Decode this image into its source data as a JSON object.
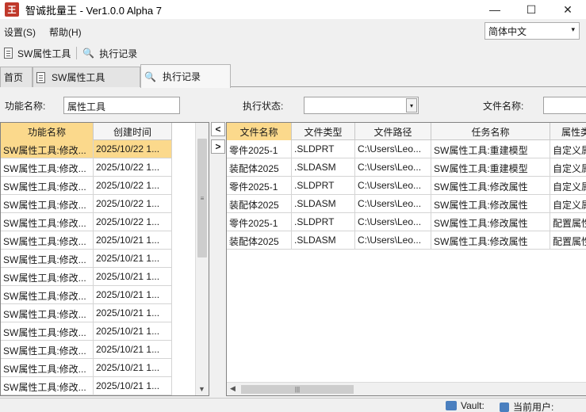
{
  "window": {
    "title": "智诚批量王 - Ver1.0.0 Alpha 7",
    "app_icon_text": "王",
    "minimize": "—",
    "maximize": "☐",
    "close": "✕"
  },
  "menu": {
    "items": [
      {
        "label": "设置(S)"
      },
      {
        "label": "帮助(H)"
      }
    ],
    "language": {
      "value": "简体中文",
      "arrow": "▾"
    }
  },
  "toolbar": {
    "sw_tool_label": "SW属性工具",
    "exec_log_label": "执行记录"
  },
  "tabs": [
    {
      "label": "首页"
    },
    {
      "label": "SW属性工具"
    },
    {
      "label": "执行记录"
    }
  ],
  "filters": {
    "function_name_label": "功能名称:",
    "function_name_value": "属性工具",
    "exec_status_label": "执行状态:",
    "exec_status_value": "",
    "combo_arrow": "▾",
    "file_name_label": "文件名称:",
    "file_name_value": ""
  },
  "left_table": {
    "columns": [
      "功能名称",
      "创建时间"
    ],
    "rows": [
      [
        "SW属性工具:修改...",
        "2025/10/22 1..."
      ],
      [
        "SW属性工具:修改...",
        "2025/10/22 1..."
      ],
      [
        "SW属性工具:修改...",
        "2025/10/22 1..."
      ],
      [
        "SW属性工具:修改...",
        "2025/10/22 1..."
      ],
      [
        "SW属性工具:修改...",
        "2025/10/22 1..."
      ],
      [
        "SW属性工具:修改...",
        "2025/10/21 1..."
      ],
      [
        "SW属性工具:修改...",
        "2025/10/21 1..."
      ],
      [
        "SW属性工具:修改...",
        "2025/10/21 1..."
      ],
      [
        "SW属性工具:修改...",
        "2025/10/21 1..."
      ],
      [
        "SW属性工具:修改...",
        "2025/10/21 1..."
      ],
      [
        "SW属性工具:修改...",
        "2025/10/21 1..."
      ],
      [
        "SW属性工具:修改...",
        "2025/10/21 1..."
      ],
      [
        "SW属性工具:修改...",
        "2025/10/21 1..."
      ],
      [
        "SW属性工具:修改...",
        "2025/10/21 1..."
      ]
    ],
    "selected_row": 0
  },
  "splitter": {
    "collapse": "<",
    "expand": ">"
  },
  "right_table": {
    "columns": [
      "文件名称",
      "文件类型",
      "文件路径",
      "任务名称",
      "属性类"
    ],
    "rows": [
      [
        "零件2025-1",
        ".SLDPRT",
        "C:\\Users\\Leo...",
        "SW属性工具:重建模型",
        "自定义属"
      ],
      [
        "装配体2025",
        ".SLDASM",
        "C:\\Users\\Leo...",
        "SW属性工具:重建模型",
        "自定义属"
      ],
      [
        "零件2025-1",
        ".SLDPRT",
        "C:\\Users\\Leo...",
        "SW属性工具:修改属性",
        "自定义属"
      ],
      [
        "装配体2025",
        ".SLDASM",
        "C:\\Users\\Leo...",
        "SW属性工具:修改属性",
        "自定义属"
      ],
      [
        "零件2025-1",
        ".SLDPRT",
        "C:\\Users\\Leo...",
        "SW属性工具:修改属性",
        "配置属性"
      ],
      [
        "装配体2025",
        ".SLDASM",
        "C:\\Users\\Leo...",
        "SW属性工具:修改属性",
        "配置属性"
      ]
    ]
  },
  "scroll": {
    "grip": "≡",
    "hgrip": "|||",
    "down": "▼",
    "left": "◀"
  },
  "status": {
    "vault_label": "Vault:",
    "user_label": "当前用户:"
  },
  "colors": {
    "selected": "#fbd98c",
    "app_icon": "#c0392b"
  }
}
